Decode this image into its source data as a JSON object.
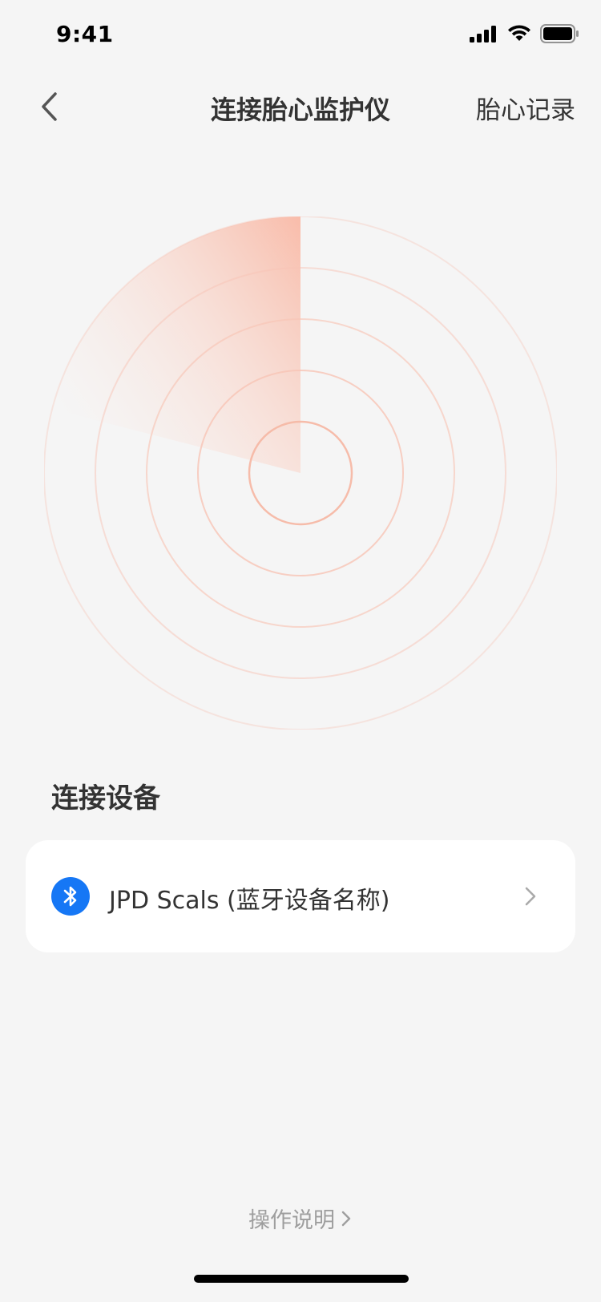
{
  "status_bar": {
    "time": "9:41",
    "icons": [
      "signal-icon",
      "wifi-icon",
      "battery-icon"
    ]
  },
  "nav": {
    "back_icon": "chevron-left-icon",
    "title": "连接胎心监护仪",
    "right_action": "胎心记录"
  },
  "radar": {
    "accent_color": "#F9B9A6",
    "ring_color": "#F7C4B5"
  },
  "section": {
    "title": "连接设备"
  },
  "devices": [
    {
      "icon": "bluetooth-icon",
      "name": "JPD Scals (蓝牙设备名称)",
      "chevron": "chevron-right-icon"
    }
  ],
  "footer": {
    "help_label": "操作说明",
    "help_icon": "chevron-right-icon"
  },
  "colors": {
    "background": "#F5F5F5",
    "card": "#FFFFFF",
    "bluetooth": "#1677F5",
    "text_primary": "#333333",
    "text_secondary": "#9E9E9E"
  }
}
